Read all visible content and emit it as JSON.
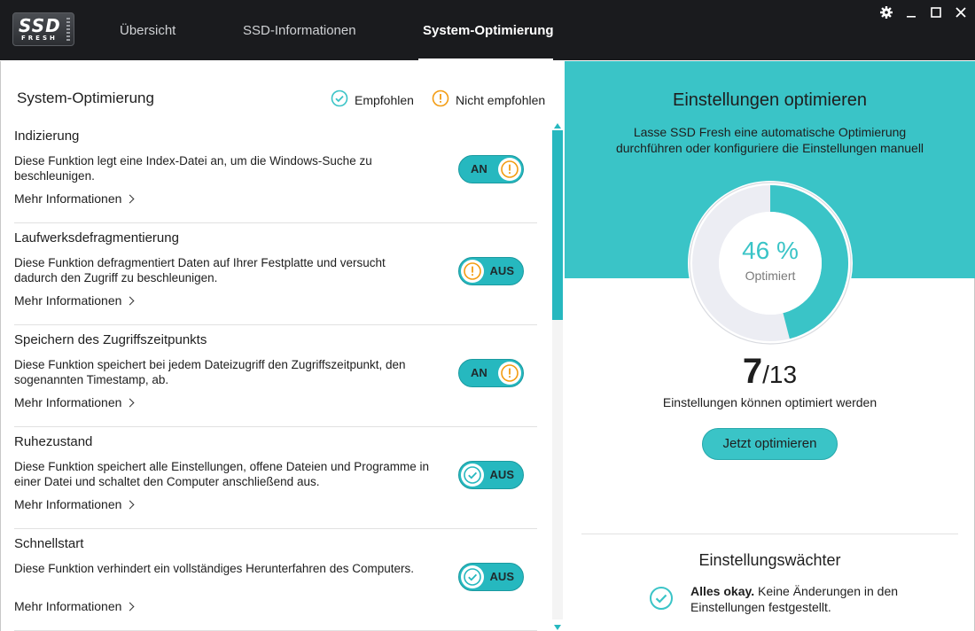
{
  "app": {
    "logo_text": "SSD",
    "logo_subtext": "FRESH"
  },
  "nav": {
    "tabs": [
      {
        "label": "Übersicht",
        "active": false
      },
      {
        "label": "SSD-Informationen",
        "active": false
      },
      {
        "label": "System-Optimierung",
        "active": true
      }
    ]
  },
  "window_controls": [
    "gear-icon",
    "minimize-icon",
    "maximize-icon",
    "close-icon"
  ],
  "left": {
    "title": "System-Optimierung",
    "legend": {
      "recommended": "Empfohlen",
      "not_recommended": "Nicht empfohlen"
    },
    "settings": [
      {
        "title": "Indizierung",
        "description": "Diese Funktion legt eine Index-Datei an, um die Windows-Suche zu beschleunigen.",
        "more": "Mehr Informationen",
        "state": "AN",
        "status_icon": "warning-icon"
      },
      {
        "title": "Laufwerksdefragmentierung",
        "description": "Diese Funktion defragmentiert Daten auf Ihrer Festplatte und versucht dadurch den Zugriff zu beschleunigen.",
        "more": "Mehr Informationen",
        "state": "AUS",
        "status_icon": "warning-icon"
      },
      {
        "title": "Speichern des Zugriffszeitpunkts",
        "description": "Diese Funktion speichert bei jedem Dateizugriff den Zugriffszeitpunkt, den sogenannten Timestamp, ab.",
        "more": "Mehr Informationen",
        "state": "AN",
        "status_icon": "warning-icon"
      },
      {
        "title": "Ruhezustand",
        "description": "Diese Funktion speichert alle Einstellungen, offene Dateien und Programme in einer Datei und schaltet den Computer anschließend aus.",
        "more": "Mehr Informationen",
        "state": "AUS",
        "status_icon": "check-icon"
      },
      {
        "title": "Schnellstart",
        "description": "Diese Funktion verhindert ein vollständiges Herunterfahren des Computers.",
        "more": "Mehr Informationen",
        "state": "AUS",
        "status_icon": "check-icon"
      }
    ]
  },
  "right": {
    "title": "Einstellungen optimieren",
    "subtitle": "Lasse SSD Fresh eine automatische Optimierung durchführen oder konfiguriere die Einstellungen manuell",
    "percent_text": "46 %",
    "percent_value": 46,
    "percent_label": "Optimiert",
    "count_big": "7",
    "count_rest": "/13",
    "count_label": "Einstellungen können optimiert werden",
    "button": "Jetzt optimieren",
    "watch_title": "Einstellungswächter",
    "watch_bold": "Alles okay.",
    "watch_text": " Keine Änderungen in den Einstellungen festgestellt."
  },
  "colors": {
    "teal": "#3ac4c7",
    "toggle_teal": "#26b8bf",
    "warning_orange": "#f39c12",
    "titlebar": "#1a1b1e"
  }
}
